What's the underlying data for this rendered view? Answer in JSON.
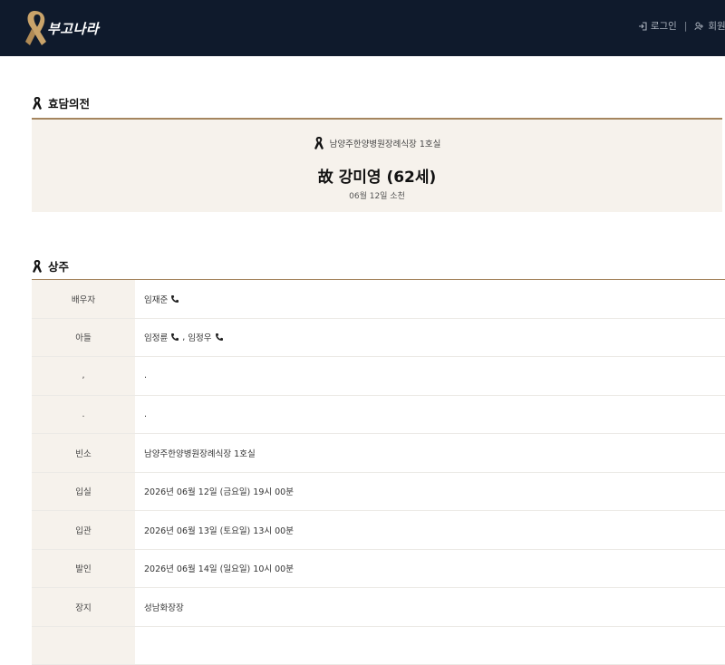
{
  "brand": {
    "name": "부고나라"
  },
  "header": {
    "login": "로그인",
    "separator": "|",
    "signup": "회원가입"
  },
  "sections": {
    "hyodam": "효담의전",
    "sangju": "상주"
  },
  "notice": {
    "hall": "남양주한양병원장례식장 1호실",
    "deceased": "故 강미영 (62세)",
    "date": "06월 12일 소천"
  },
  "mourners": {
    "spouse_label": "배우자",
    "spouse_name": "임재준",
    "sons_label": "아들",
    "son1": "임정륜",
    "comma": ",",
    "son2": "임정우",
    "row3_label": ",",
    "row3_value": ".",
    "row4_label": ".",
    "row4_value": ".",
    "binso_label": "빈소",
    "binso_value": "남양주한양병원장례식장 1호실",
    "ipsil_label": "입실",
    "ipsil_value": "2026년 06월 12일 (금요일) 19시 00분",
    "ipgwan_label": "입관",
    "ipgwan_value": "2026년 06월 13일 (토요일) 13시 00분",
    "barin_label": "발인",
    "barin_value": "2026년 06월 14일 (일요일) 10시 00분",
    "jangji_label": "장지",
    "jangji_value": "성남화장장"
  },
  "colors": {
    "header_bg": "#0f1a2c",
    "accent": "#a5855f",
    "box_bg": "#f6f2ec"
  },
  "icons": [
    "ribbon-logo-icon",
    "login-icon",
    "signup-icon",
    "mourning-ribbon-icon",
    "phone-icon"
  ]
}
